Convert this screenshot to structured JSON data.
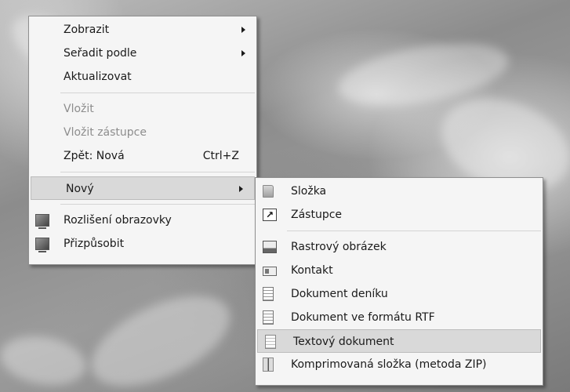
{
  "context_menu": {
    "items": [
      {
        "label": "Zobrazit",
        "submenu": true,
        "enabled": true
      },
      {
        "label": "Seřadit podle",
        "submenu": true,
        "enabled": true
      },
      {
        "label": "Aktualizovat",
        "enabled": true
      },
      {
        "label": "Vložit",
        "enabled": false
      },
      {
        "label": "Vložit zástupce",
        "enabled": false
      },
      {
        "label": "Zpět: Nová",
        "shortcut": "Ctrl+Z",
        "enabled": true
      },
      {
        "label": "Nový",
        "submenu": true,
        "enabled": true,
        "highlighted": true
      },
      {
        "label": "Rozlišení obrazovky",
        "icon": "monitor-resolution-icon",
        "enabled": true
      },
      {
        "label": "Přizpůsobit",
        "icon": "personalize-icon",
        "enabled": true
      }
    ]
  },
  "new_submenu": {
    "items": [
      {
        "label": "Složka",
        "icon": "folder-icon"
      },
      {
        "label": "Zástupce",
        "icon": "shortcut-icon"
      },
      {
        "label": "Rastrový obrázek",
        "icon": "bitmap-image-icon"
      },
      {
        "label": "Kontakt",
        "icon": "contact-icon"
      },
      {
        "label": "Dokument deníku",
        "icon": "journal-document-icon"
      },
      {
        "label": "Dokument ve formátu RTF",
        "icon": "rtf-document-icon"
      },
      {
        "label": "Textový dokument",
        "icon": "text-document-icon",
        "highlighted": true
      },
      {
        "label": "Komprimovaná složka (metoda ZIP)",
        "icon": "zip-folder-icon"
      }
    ]
  },
  "colors": {
    "menu_background": "#f5f5f5",
    "highlight": "#d9d9d9",
    "disabled_text": "#8d8d8d"
  }
}
